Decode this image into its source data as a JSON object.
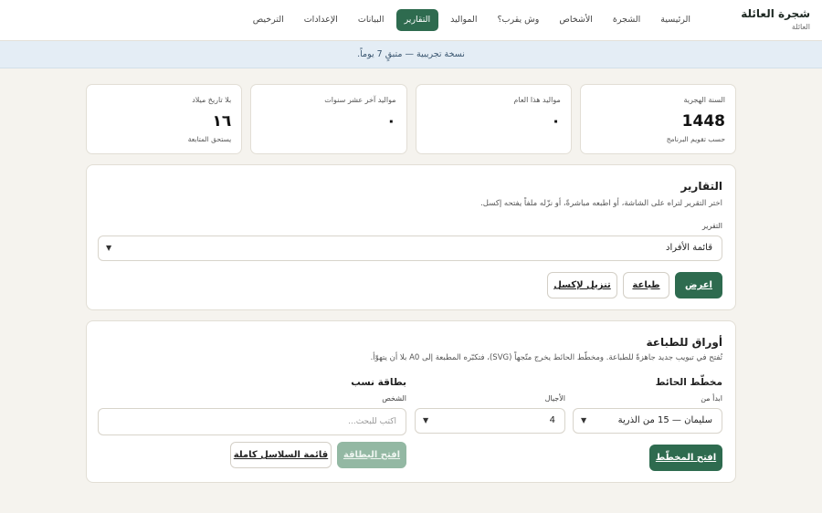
{
  "header": {
    "brand_title": "شجرة العائلة",
    "brand_subtitle": "العائلة",
    "nav": [
      {
        "label": "الرئيسية",
        "active": false
      },
      {
        "label": "الشجرة",
        "active": false
      },
      {
        "label": "الأشخاص",
        "active": false
      },
      {
        "label": "وش يقرب؟",
        "active": false
      },
      {
        "label": "المواليد",
        "active": false
      },
      {
        "label": "التقارير",
        "active": true
      },
      {
        "label": "البيانات",
        "active": false
      },
      {
        "label": "الإعدادات",
        "active": false
      },
      {
        "label": "الترخيص",
        "active": false
      }
    ]
  },
  "banner": {
    "text": "نسخة تجريبية — متبقٍ 7 يوماً."
  },
  "stats": [
    {
      "label": "السنة الهجرية",
      "value": "1448",
      "note": "حسب تقويم البرنامج"
    },
    {
      "label": "مواليد هذا العام",
      "value": "٠",
      "note": ""
    },
    {
      "label": "مواليد آخر عشر سنوات",
      "value": "٠",
      "note": ""
    },
    {
      "label": "بلا تاريخ ميلاد",
      "value": "١٦",
      "note": "يستحق المتابعة"
    }
  ],
  "reports": {
    "title": "التقارير",
    "description": "اختر التقرير لتراه على الشاشة، أو اطبعه مباشرةً، أو نزّله ملفاً يفتحه إكسل.",
    "select_label": "التقرير",
    "selected_report": "قائمة الأفراد",
    "view_label": "اعرض",
    "print_label": "طباعة",
    "download_label": "تنزيل لإكسل"
  },
  "print_sheets": {
    "title": "أوراق للطباعة",
    "description": "تُفتح في تبويب جديد جاهزةً للطباعة. ومخطّط الحائط يخرج متّجهاً (SVG)، فتكبّره المطبعة إلى A0 بلا أن يتهوّأ.",
    "wall_chart": {
      "heading": "مخطّط الحائط",
      "start_label": "ابدأ من",
      "start_value": "سليمان — 15 من الذرية",
      "generations_label": "الأجيال",
      "generations_value": "4",
      "open_label": "افتح المخطّط"
    },
    "lineage_card": {
      "heading": "بطاقة نسب",
      "person_label": "الشخص",
      "person_placeholder": "اكتب للبحث...",
      "open_label": "افتح البطاقة",
      "full_list_label": "قائمة السلاسل كاملة"
    }
  }
}
